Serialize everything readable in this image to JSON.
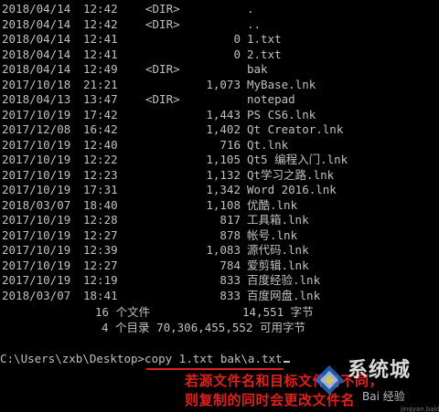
{
  "listing": [
    {
      "date": "2018/04/14",
      "time": "12:42",
      "dir": "<DIR>",
      "size": "",
      "name": "."
    },
    {
      "date": "2018/04/14",
      "time": "12:42",
      "dir": "<DIR>",
      "size": "",
      "name": ".."
    },
    {
      "date": "2018/04/14",
      "time": "12:41",
      "dir": "",
      "size": "0",
      "name": "1.txt"
    },
    {
      "date": "2018/04/14",
      "time": "12:41",
      "dir": "",
      "size": "0",
      "name": "2.txt"
    },
    {
      "date": "2018/04/14",
      "time": "12:49",
      "dir": "<DIR>",
      "size": "",
      "name": "bak"
    },
    {
      "date": "2017/10/18",
      "time": "21:21",
      "dir": "",
      "size": "1,073",
      "name": "MyBase.lnk"
    },
    {
      "date": "2018/04/13",
      "time": "13:47",
      "dir": "<DIR>",
      "size": "",
      "name": "notepad"
    },
    {
      "date": "2017/10/19",
      "time": "17:42",
      "dir": "",
      "size": "1,443",
      "name": "PS CS6.lnk"
    },
    {
      "date": "2017/12/08",
      "time": "16:42",
      "dir": "",
      "size": "1,402",
      "name": "Qt Creator.lnk"
    },
    {
      "date": "2017/10/19",
      "time": "12:40",
      "dir": "",
      "size": "716",
      "name": "Qt.lnk"
    },
    {
      "date": "2017/10/19",
      "time": "12:22",
      "dir": "",
      "size": "1,105",
      "name": "Qt5 编程入门.lnk"
    },
    {
      "date": "2017/10/19",
      "time": "12:23",
      "dir": "",
      "size": "1,132",
      "name": "Qt学习之路.lnk"
    },
    {
      "date": "2017/10/19",
      "time": "17:31",
      "dir": "",
      "size": "1,342",
      "name": "Word 2016.lnk"
    },
    {
      "date": "2018/03/07",
      "time": "18:40",
      "dir": "",
      "size": "1,108",
      "name": "优酷.lnk"
    },
    {
      "date": "2017/10/19",
      "time": "12:28",
      "dir": "",
      "size": "817",
      "name": "工具箱.lnk"
    },
    {
      "date": "2017/10/19",
      "time": "12:27",
      "dir": "",
      "size": "878",
      "name": "帐号.lnk"
    },
    {
      "date": "2017/10/19",
      "time": "12:39",
      "dir": "",
      "size": "1,083",
      "name": "源代码.lnk"
    },
    {
      "date": "2017/10/19",
      "time": "12:27",
      "dir": "",
      "size": "784",
      "name": "爱剪辑.lnk"
    },
    {
      "date": "2017/10/19",
      "time": "12:19",
      "dir": "",
      "size": "833",
      "name": "百度经验.lnk"
    },
    {
      "date": "2018/03/07",
      "time": "18:41",
      "dir": "",
      "size": "833",
      "name": "百度网盘.lnk"
    }
  ],
  "summary": {
    "files_line": "16 个文件",
    "files_bytes": "14,551 字节",
    "dirs_line": "4 个目录 70,306,455,552 可用字节"
  },
  "prompt": {
    "path": "C:\\Users\\zxb\\Desktop>",
    "command": "copy 1.txt bak\\a.txt"
  },
  "annotation": {
    "line1": "若源文件名和目标文件名不同，",
    "line2": "则复制的同时会更改文件名"
  },
  "watermark": {
    "brand": "系统城",
    "sub": "Bai 经验",
    "url": "jingyan.baidu.com"
  },
  "colors": {
    "background": "#000000",
    "text": "#c0c0c0",
    "annotation": "#e0201a"
  }
}
